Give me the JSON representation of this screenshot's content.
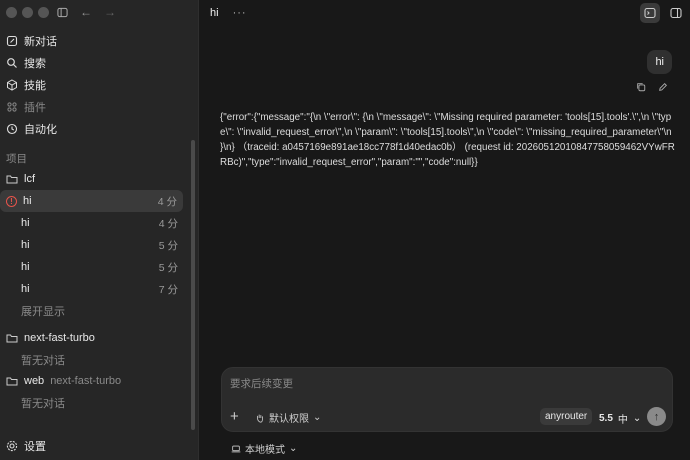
{
  "header": {
    "title": "hi",
    "more": "···"
  },
  "nav": [
    {
      "label": "新对话",
      "icon": "edit-icon"
    },
    {
      "label": "搜索",
      "icon": "search-icon"
    },
    {
      "label": "技能",
      "icon": "cube-icon"
    },
    {
      "label": "插件",
      "icon": "grid-icon"
    },
    {
      "label": "自动化",
      "icon": "clock-icon"
    }
  ],
  "section_label": "项目",
  "project_lcf": "lcf",
  "threads": [
    {
      "title": "hi",
      "time": "4 分",
      "error": true
    },
    {
      "title": "hi",
      "time": "4 分"
    },
    {
      "title": "hi",
      "time": "5 分"
    },
    {
      "title": "hi",
      "time": "5 分"
    },
    {
      "title": "hi",
      "time": "7 分"
    }
  ],
  "show_more": "展开显示",
  "project_next": "next-fast-turbo",
  "empty_next": "暂无对话",
  "project_web": "web",
  "project_web_sub": "next-fast-turbo",
  "empty_web": "暂无对话",
  "settings": "设置",
  "user_message": "hi",
  "error_text": "{\"error\":{\"message\":\"{\\n \\\"error\\\": {\\n \\\"message\\\": \\\"Missing required parameter: 'tools[15].tools'.\\\",\\n \\\"type\\\": \\\"invalid_request_error\\\",\\n \\\"param\\\": \\\"tools[15].tools\\\",\\n \\\"code\\\": \\\"missing_required_parameter\\\"\\n }\\n} （traceid: a0457169e891ae18cc778f1d40edac0b） (request id: 20260512010847758059462VYwFRRBc)\",\"type\":\"invalid_request_error\",\"param\":\"\",\"code\":null}}",
  "composer": {
    "placeholder": "要求后续变更",
    "permission": "默认权限",
    "model": "anyrouter",
    "version": "5.5",
    "effort": "中"
  },
  "local_mode": "本地模式"
}
